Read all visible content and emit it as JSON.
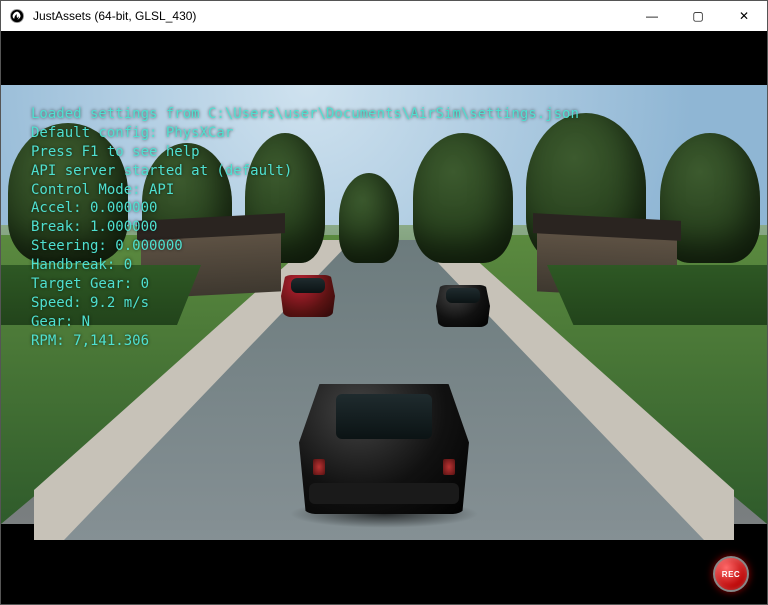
{
  "window": {
    "title": "JustAssets (64-bit, GLSL_430)",
    "app_icon_name": "unreal-engine-icon",
    "controls": {
      "minimize": "—",
      "maximize": "▢",
      "close": "✕"
    }
  },
  "hud": {
    "lines": [
      "Loaded settings from C:\\Users\\user\\Documents\\AirSim\\settings.json",
      "Default config: PhysXCar",
      "Press F1 to see help",
      "API server started at (default)",
      "Control Mode: API",
      "Accel: 0.000000",
      "Break: 1.000000",
      "Steering: 0.000000",
      "Handbreak: 0",
      "Target Gear: 0",
      "Speed: 9.2 m/s",
      "Gear: N",
      "RPM: 7,141.306"
    ]
  },
  "recorder": {
    "label": "REC"
  },
  "telemetry": {
    "control_mode": "API",
    "accel": 0.0,
    "break": 1.0,
    "steering": 0.0,
    "handbreak": 0,
    "target_gear": 0,
    "speed_mps": 9.2,
    "gear": "N",
    "rpm": 7141.306
  }
}
